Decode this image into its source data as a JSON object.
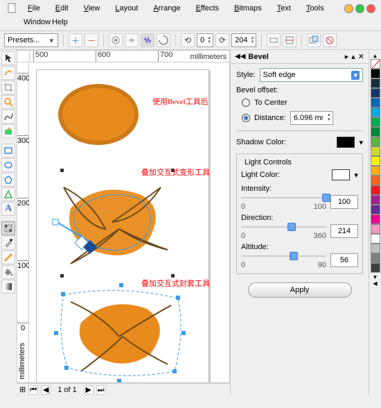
{
  "menus": {
    "file": "File",
    "edit": "Edit",
    "view": "View",
    "layout": "Layout",
    "arrange": "Arrange",
    "effects": "Effects",
    "bitmaps": "Bitmaps",
    "text": "Text",
    "tools": "Tools",
    "window": "Window",
    "help": "Help"
  },
  "window_controls": {
    "min": "#fdbc40",
    "max": "#33c748",
    "close": "#fc5753"
  },
  "toolbar": {
    "presets_label": "Presets...",
    "rotate_value": "0",
    "copies_value": "204"
  },
  "ruler": {
    "unit": "millimeters",
    "h": [
      "500",
      "600",
      "700"
    ],
    "v": [
      "400",
      "300",
      "200",
      "100",
      "0"
    ]
  },
  "status": {
    "page": "1 of 1"
  },
  "annotations": {
    "a1": "使用Bevel工具后",
    "a2": "叠加交互式变形工具",
    "a3": "叠加交互式封套工具"
  },
  "panel": {
    "title": "Bevel",
    "style_label": "Style:",
    "style_value": "Soft edge",
    "offset_label": "Bevel offset:",
    "to_center": "To Center",
    "distance": "Distance:",
    "distance_value": "6.096 mm",
    "shadow_label": "Shadow Color:",
    "shadow_color": "#000000",
    "light_group": "Light Controls",
    "light_color_label": "Light Color:",
    "light_color": "#ffffff",
    "intensity_label": "Intensity:",
    "intensity": "100",
    "intensity_min": "0",
    "intensity_max": "100",
    "direction_label": "Direction:",
    "direction": "214",
    "direction_min": "0",
    "direction_max": "360",
    "altitude_label": "Altitude:",
    "altitude": "56",
    "altitude_min": "0",
    "altitude_max": "90",
    "apply": "Apply"
  },
  "palette": [
    "#000000",
    "#404040",
    "#808080",
    "#c0c0c0",
    "#ffffff",
    "#ff0000",
    "#ff8000",
    "#ffff00",
    "#80ff00",
    "#00ff00",
    "#00ff80",
    "#00ffff",
    "#0080ff",
    "#0000ff",
    "#8000ff",
    "#ff00ff",
    "#ff0080",
    "#804000",
    "#408000",
    "#004080"
  ]
}
